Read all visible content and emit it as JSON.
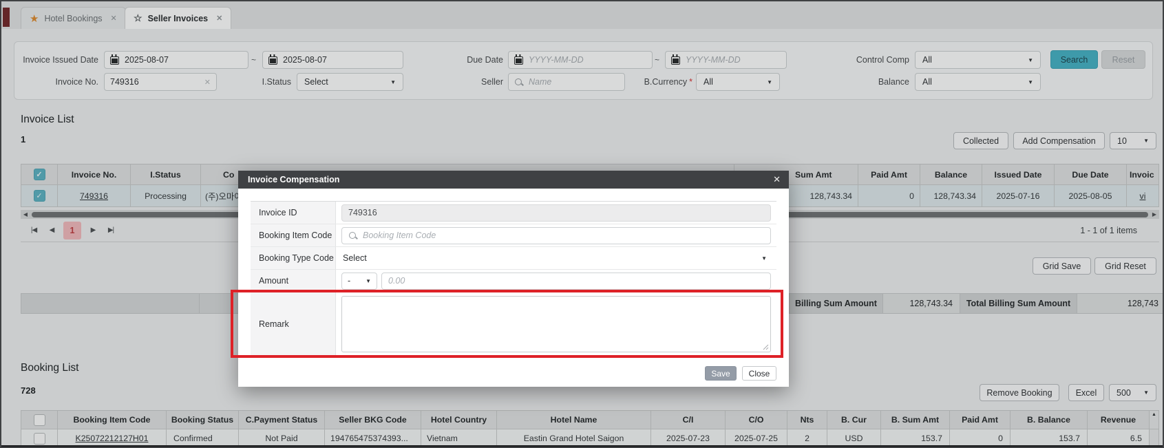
{
  "icons": {
    "caret": "▼",
    "star_filled": "★",
    "star_outline": "☆",
    "tab_close": "✕",
    "clear": "✕",
    "modal_close": "✕",
    "check": "✓",
    "pg_first": "|◀",
    "pg_prev": "◀",
    "pg_next": "▶",
    "pg_last": "▶|",
    "scroll_left": "◀",
    "scroll_right": "▶",
    "scroll_up": "▲"
  },
  "window": {
    "tabs": [
      {
        "label": "Hotel Bookings"
      },
      {
        "label": "Seller Invoices"
      }
    ]
  },
  "filters": {
    "invoice_issued_date": {
      "label": "Invoice Issued Date",
      "from": "2025-08-07",
      "to": "2025-08-07",
      "separator": "~"
    },
    "due_date": {
      "label": "Due Date",
      "from_placeholder": "YYYY-MM-DD",
      "to_placeholder": "YYYY-MM-DD",
      "separator": "~"
    },
    "control_comp": {
      "label": "Control Comp",
      "value": "All"
    },
    "invoice_no": {
      "label": "Invoice No.",
      "value": "749316"
    },
    "i_status": {
      "label": "I.Status",
      "value": "Select"
    },
    "seller": {
      "label": "Seller",
      "placeholder": "Name"
    },
    "b_currency": {
      "label": "B.Currency",
      "required_mark": "*",
      "value": "All"
    },
    "balance": {
      "label": "Balance",
      "value": "All"
    },
    "search_label": "Search",
    "reset_label": "Reset"
  },
  "invoice_list": {
    "title": "Invoice List",
    "count": "1",
    "collected_label": "Collected",
    "add_compensation_label": "Add Compensation",
    "page_size": "10",
    "columns": {
      "invoice_no": "Invoice No.",
      "i_status": "I.Status",
      "company": "Co",
      "sum_amt": "Sum Amt",
      "paid_amt": "Paid Amt",
      "balance": "Balance",
      "issued_date": "Issued Date",
      "due_date": "Due Date",
      "invoice": "Invoic"
    },
    "row": {
      "invoice_no": "749316",
      "i_status": "Processing",
      "company": "(주)오마이",
      "sum_amt": "128,743.34",
      "paid_amt": "0",
      "balance": "128,743.34",
      "issued_date": "2025-07-16",
      "due_date": "2025-08-05",
      "invoice_link": "vi"
    },
    "pagination": {
      "page": "1",
      "info": "1 - 1 of 1 items"
    },
    "grid_save_label": "Grid Save",
    "grid_reset_label": "Grid Reset",
    "summary": {
      "billing_label": "Billing Sum Amount",
      "billing_value": "128,743.34",
      "total_label": "Total Billing Sum Amount",
      "total_value": "128,743"
    }
  },
  "modal": {
    "title": "Invoice Compensation",
    "invoice_id": {
      "label": "Invoice ID",
      "value": "749316"
    },
    "booking_item_code": {
      "label": "Booking Item Code",
      "placeholder": "Booking Item Code"
    },
    "booking_type_code": {
      "label": "Booking Type Code",
      "value": "Select"
    },
    "amount": {
      "label": "Amount",
      "sign": "-",
      "placeholder": "0.00"
    },
    "remark": {
      "label": "Remark"
    },
    "save_label": "Save",
    "close_label": "Close"
  },
  "booking_list": {
    "title": "Booking List",
    "count": "728",
    "remove_booking_label": "Remove Booking",
    "excel_label": "Excel",
    "page_size": "500",
    "columns": [
      "Booking Item Code",
      "Booking Status",
      "C.Payment Status",
      "Seller BKG Code",
      "Hotel Country",
      "Hotel Name",
      "C/I",
      "C/O",
      "Nts",
      "B. Cur",
      "B. Sum Amt",
      "Paid Amt",
      "B. Balance",
      "Revenue"
    ],
    "row": [
      "K25072212127H01",
      "Confirmed",
      "Not Paid",
      "194765475374393...",
      "Vietnam",
      "Eastin Grand Hotel Saigon",
      "2025-07-23",
      "2025-07-25",
      "2",
      "USD",
      "153.7",
      "0",
      "153.7",
      "6.5"
    ]
  },
  "colors": {
    "accent_teal": "#45b2c6",
    "annotation_red": "#de2127",
    "modal_header": "#3f4144",
    "current_page_bg": "#f3babd",
    "current_page_text": "#c13b40"
  }
}
